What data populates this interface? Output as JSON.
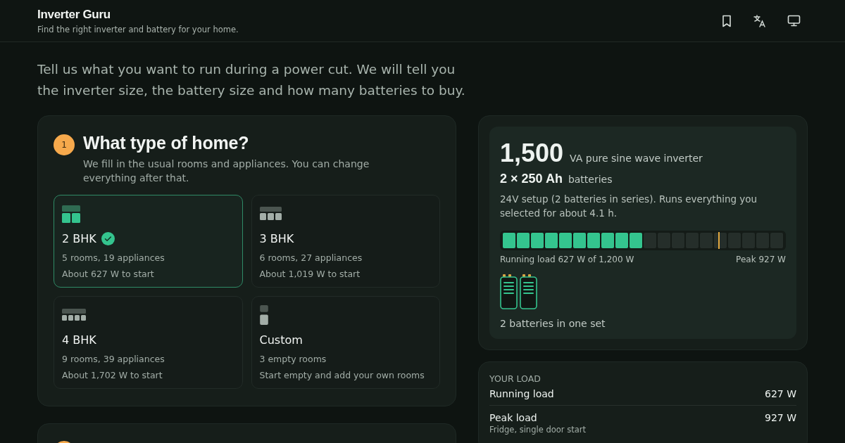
{
  "header": {
    "title": "Inverter Guru",
    "subtitle": "Find the right inverter and battery for your home.",
    "actions": [
      {
        "kind": "bookmark"
      },
      {
        "kind": "translate"
      },
      {
        "kind": "display"
      }
    ]
  },
  "intro": "Tell us what you want to run during a power cut. We will tell you the inverter size, the battery size and how many batteries to buy.",
  "step": {
    "number": "1",
    "title": "What type of home?",
    "description": "We fill in the usual rooms and appliances. You can change everything after that.",
    "options": [
      {
        "kind": "grid2",
        "name": "2 BHK",
        "rooms": "5 rooms, 19 appliances",
        "note": "About 627 W to start",
        "selected": true
      },
      {
        "kind": "grid3",
        "name": "3 BHK",
        "rooms": "6 rooms, 27 appliances",
        "note": "About 1,019 W to start",
        "selected": false
      },
      {
        "kind": "grid4",
        "name": "4 BHK",
        "rooms": "9 rooms, 39 appliances",
        "note": "About 1,702 W to start",
        "selected": false
      },
      {
        "kind": "custom",
        "name": "Custom",
        "rooms": "3 empty rooms",
        "note": "Start empty and add your own rooms",
        "selected": false
      }
    ]
  },
  "result": {
    "inverter_value": "1,500",
    "inverter_label": "VA pure sine wave inverter",
    "battery_value": "2 × 250 Ah",
    "battery_label": "batteries",
    "summary": "24V setup (2 batteries in series). Runs everything you selected for about 4.1 h.",
    "load_bar": {
      "level": 0.5225,
      "peak": {
        "level": 0.7725
      }
    },
    "load_caption": "Running load 627 W of 1,200 W",
    "peak_caption": "Peak 927 W",
    "set_caption": "2 batteries in one set"
  },
  "load": {
    "heading": "YOUR LOAD",
    "rows": [
      {
        "label": "Running load",
        "value": "627 W"
      },
      {
        "label": "Peak load",
        "value": "927 W",
        "note": "Fridge, single door start"
      }
    ]
  }
}
